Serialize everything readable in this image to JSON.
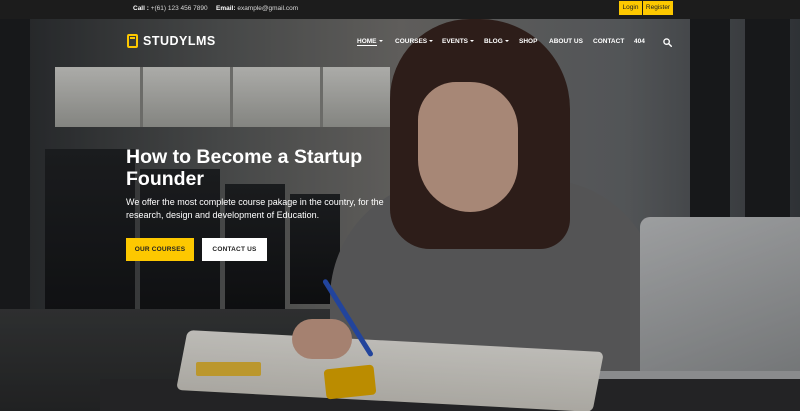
{
  "topbar": {
    "call_label": "Call :",
    "call_value": "+(61) 123 456 7890",
    "email_label": "Email:",
    "email_value": "example@gmail.com",
    "login": "Login",
    "register": "Register"
  },
  "brand": {
    "logo_text": "STUDYLMS",
    "accent_color": "#fdc800"
  },
  "nav": {
    "items": [
      {
        "label": "HOME",
        "dropdown": true,
        "active": true
      },
      {
        "label": "COURSES",
        "dropdown": true
      },
      {
        "label": "EVENTS",
        "dropdown": true
      },
      {
        "label": "BLOG",
        "dropdown": true
      },
      {
        "label": "SHOP",
        "dropdown": false
      },
      {
        "label": "ABOUT US",
        "dropdown": false
      },
      {
        "label": "CONTACT",
        "dropdown": false
      },
      {
        "label": "404",
        "dropdown": false
      }
    ],
    "search_icon": "search-icon"
  },
  "hero": {
    "title": "How to Become a Startup Founder",
    "subtitle": "We offer the most complete course pakage in the country, for the research, design and development of Education.",
    "primary_button": "OUR COURSES",
    "secondary_button": "CONTACT US"
  }
}
